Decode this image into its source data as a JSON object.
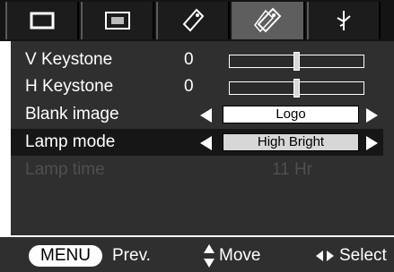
{
  "tabs": [
    {
      "icon": "picture-icon",
      "active": false
    },
    {
      "icon": "screen-icon",
      "active": false
    },
    {
      "icon": "setup-tag-icon",
      "active": false
    },
    {
      "icon": "settings-tags-icon",
      "active": true
    },
    {
      "icon": "connection-icon",
      "active": false
    }
  ],
  "menu": {
    "v_keystone": {
      "label": "V Keystone",
      "value": "0",
      "level": 0.5
    },
    "h_keystone": {
      "label": "H Keystone",
      "value": "0",
      "level": 0.5
    },
    "blank_image": {
      "label": "Blank image",
      "option": "Logo"
    },
    "lamp_mode": {
      "label": "Lamp mode",
      "option": "High Bright",
      "selected": true
    },
    "lamp_time": {
      "label": "Lamp time",
      "value": "11 Hr",
      "disabled": true
    }
  },
  "footer": {
    "menu_key": "MENU",
    "prev_label": "Prev.",
    "move_label": "Move",
    "select_label": "Select"
  },
  "colors": {
    "panel": "#2f2f2f",
    "selected_row": "#161616",
    "tab_active": "#5e5e5e",
    "disabled_text": "#4f4f4f"
  }
}
